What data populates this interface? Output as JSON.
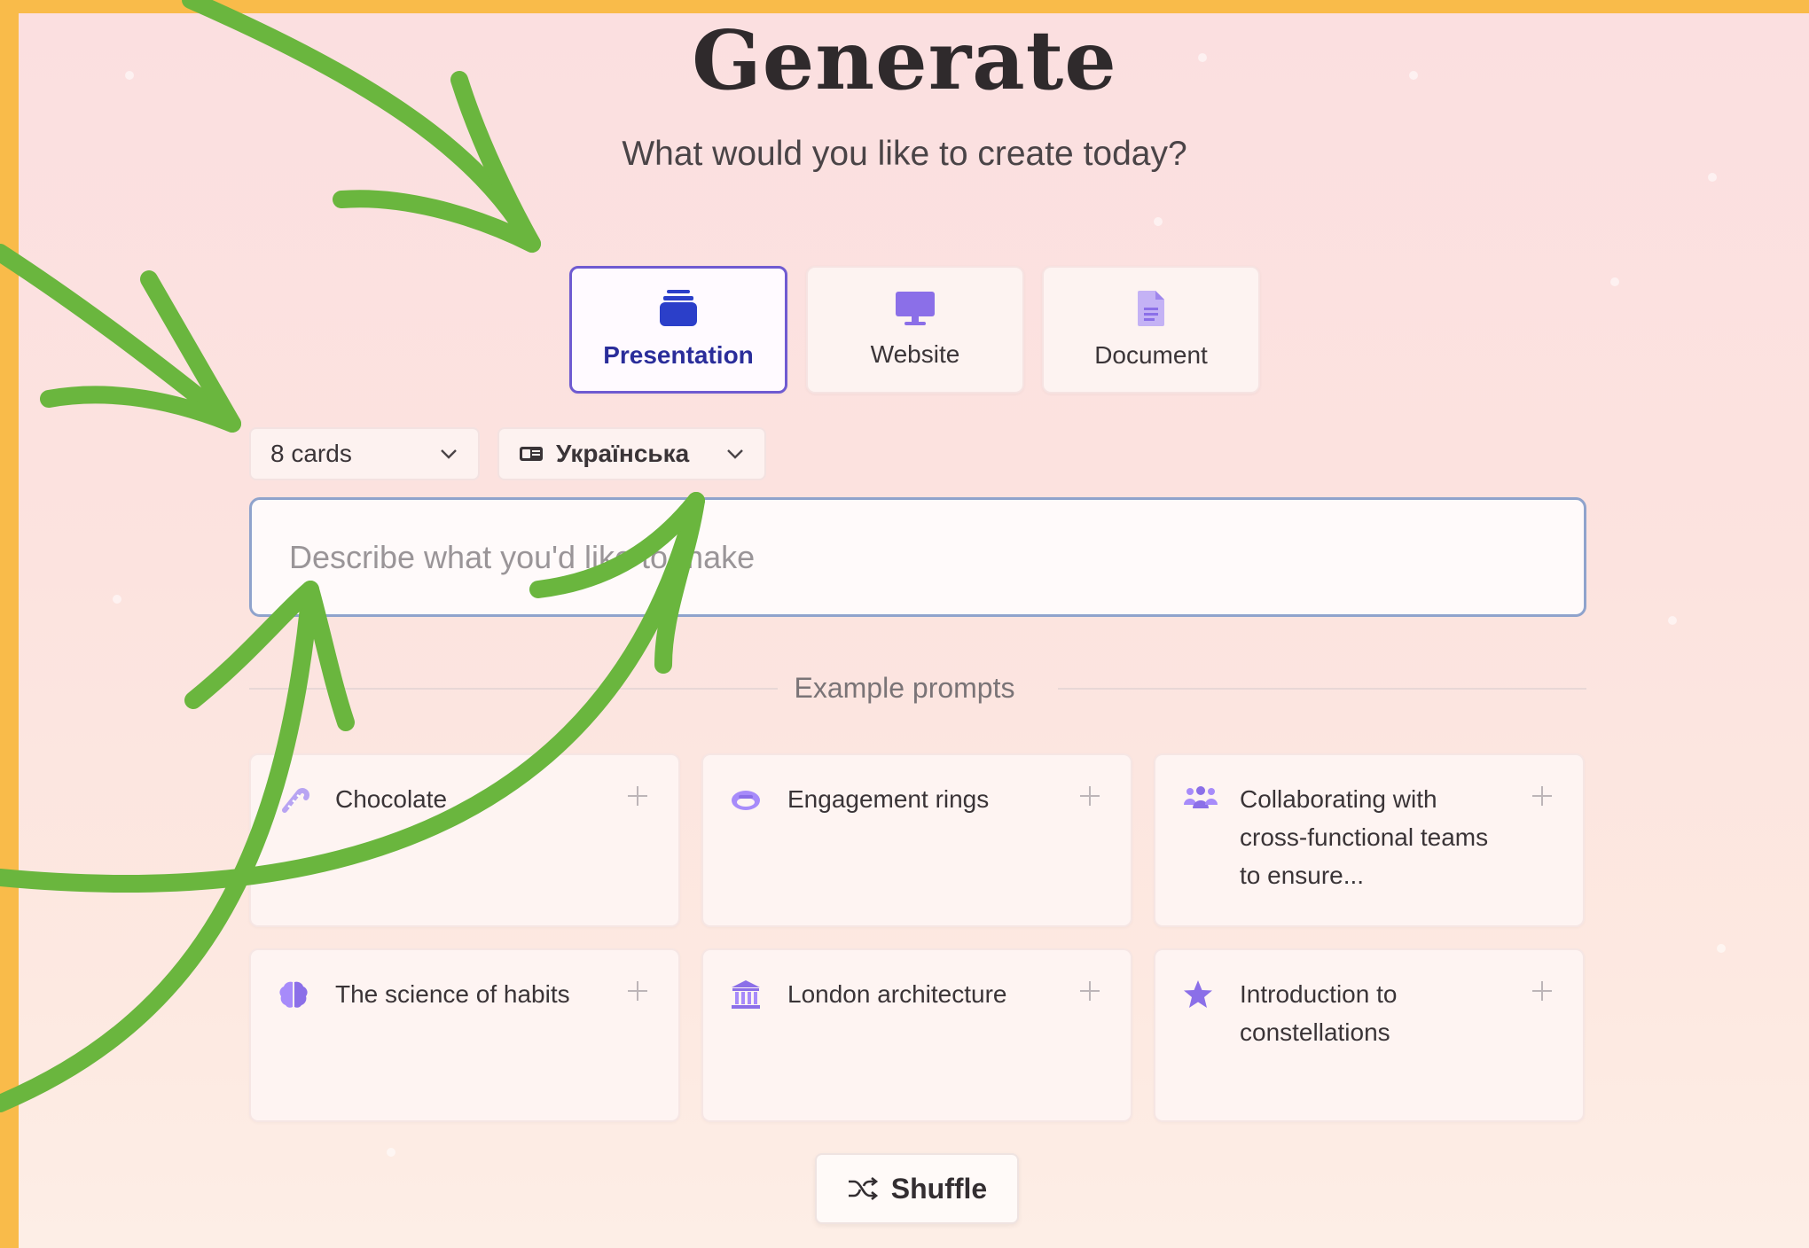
{
  "header": {
    "title": "Generate",
    "subtitle": "What would you like to create today?"
  },
  "content_types": [
    {
      "label": "Presentation",
      "icon": "presentation-stack-icon",
      "selected": true
    },
    {
      "label": "Website",
      "icon": "monitor-icon",
      "selected": false
    },
    {
      "label": "Document",
      "icon": "document-icon",
      "selected": false
    }
  ],
  "options": {
    "cards": "8 cards",
    "language": "Українська"
  },
  "prompt": {
    "placeholder": "Describe what you'd like to make",
    "value": ""
  },
  "examples": {
    "heading": "Example prompts",
    "items": [
      {
        "text": "Chocolate",
        "icon": "candy-cane-icon"
      },
      {
        "text": "Engagement rings",
        "icon": "ring-icon"
      },
      {
        "text": "Collaborating with cross-functional teams to ensure...",
        "icon": "people-group-icon"
      },
      {
        "text": "The science of habits",
        "icon": "brain-icon"
      },
      {
        "text": "London architecture",
        "icon": "museum-building-icon"
      },
      {
        "text": "Introduction to constellations",
        "icon": "star-icon"
      }
    ]
  },
  "shuffle_label": "Shuffle",
  "colors": {
    "frame": "#f9bb4a",
    "accent": "#6f5bd1",
    "icon_purple": "#a78bfa",
    "arrow_green": "#6ab63e"
  }
}
